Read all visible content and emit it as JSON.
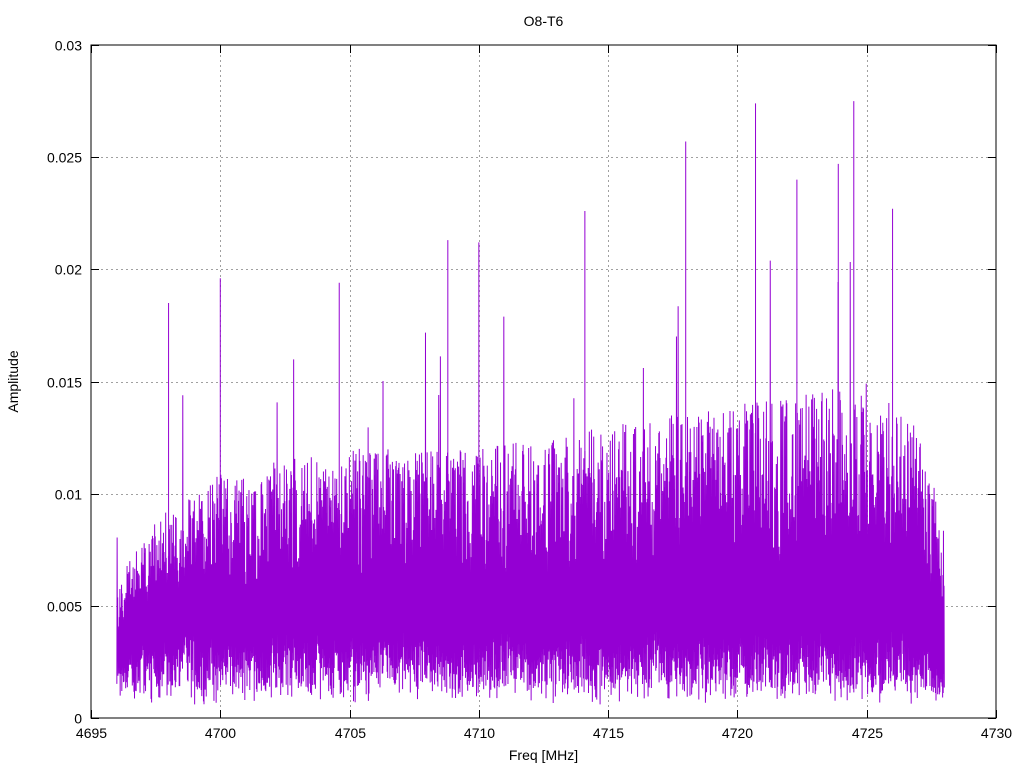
{
  "chart_data": {
    "type": "line",
    "title": "O8-T6",
    "xlabel": "Freq [MHz]",
    "ylabel": "Amplitude",
    "xlim": [
      4695,
      4730
    ],
    "ylim": [
      0,
      0.03
    ],
    "xticks": [
      4695,
      4700,
      4705,
      4710,
      4715,
      4720,
      4725,
      4730
    ],
    "xtick_labels": [
      "4695",
      "4700",
      "4705",
      "4710",
      "4715",
      "4720",
      "4725",
      "4730"
    ],
    "yticks": [
      0,
      0.005,
      0.01,
      0.015,
      0.02,
      0.025,
      0.03
    ],
    "ytick_labels": [
      "0",
      "0.005",
      "0.01",
      "0.015",
      "0.02",
      "0.025",
      "0.03"
    ],
    "grid": true,
    "series": [
      {
        "color": "#9400d3",
        "x_range": [
          4696.0,
          4728.0
        ],
        "band_envelope": {
          "x": [
            4696.0,
            4697.5,
            4700,
            4705,
            4710,
            4715,
            4720,
            4725,
            4727.0,
            4728.0
          ],
          "typical_low": [
            0.002,
            0.003,
            0.003,
            0.003,
            0.003,
            0.003,
            0.003,
            0.003,
            0.003,
            0.001
          ],
          "typical_high": [
            0.006,
            0.009,
            0.011,
            0.012,
            0.012,
            0.013,
            0.014,
            0.015,
            0.013,
            0.009
          ]
        },
        "peaks": [
          {
            "x": 4698.0,
            "y": 0.0185
          },
          {
            "x": 4700.0,
            "y": 0.0196
          },
          {
            "x": 4704.6,
            "y": 0.0194
          },
          {
            "x": 4708.8,
            "y": 0.0213
          },
          {
            "x": 4710.0,
            "y": 0.0212
          },
          {
            "x": 4714.1,
            "y": 0.0226
          },
          {
            "x": 4718.0,
            "y": 0.0257
          },
          {
            "x": 4720.7,
            "y": 0.0274
          },
          {
            "x": 4722.3,
            "y": 0.024
          },
          {
            "x": 4723.9,
            "y": 0.0247
          },
          {
            "x": 4724.5,
            "y": 0.0275
          },
          {
            "x": 4726.0,
            "y": 0.0227
          }
        ]
      }
    ]
  }
}
